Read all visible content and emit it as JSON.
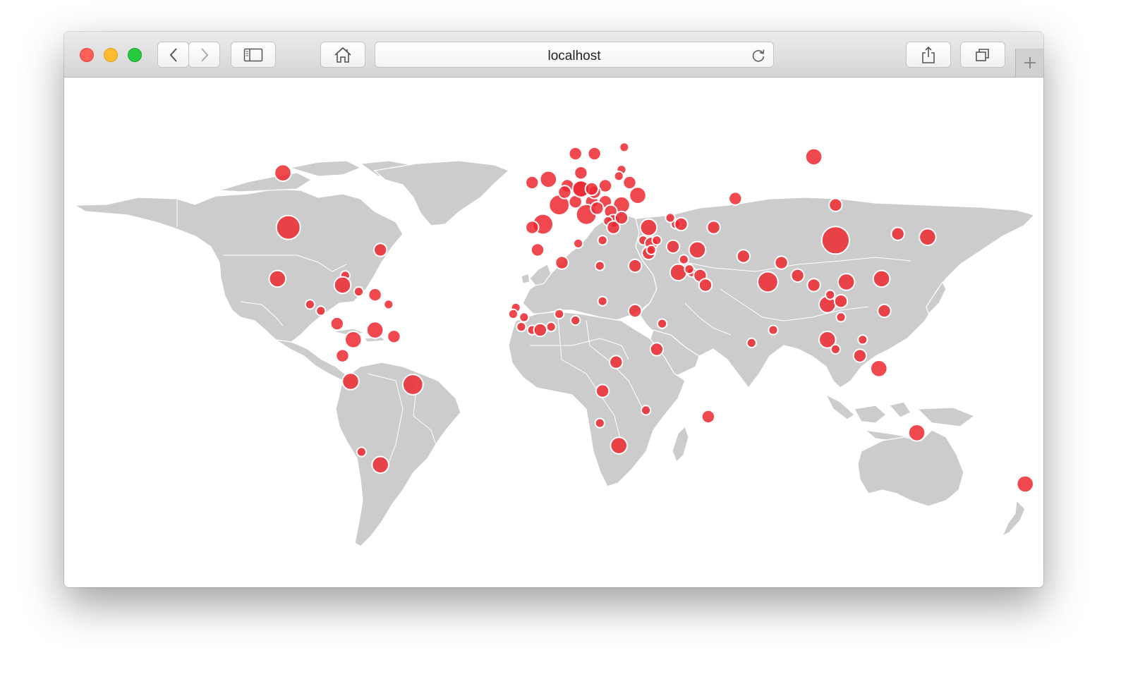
{
  "browser": {
    "url": "localhost",
    "icons": {
      "back": "chevron-left-icon",
      "forward": "chevron-right-icon",
      "sidebar": "sidebar-icon",
      "home": "home-icon",
      "reload": "reload-icon",
      "share": "share-icon",
      "tabs": "tabs-overview-icon",
      "new_tab": "plus-icon"
    }
  },
  "map": {
    "land_color": "#cccccc",
    "marker_color": "#ed2830",
    "marker_stroke": "#ffffff",
    "markers": [
      {
        "lon": -100,
        "lat": 56,
        "size": 3
      },
      {
        "lon": -98,
        "lat": 39,
        "size": 5
      },
      {
        "lon": -102,
        "lat": 23,
        "size": 3
      },
      {
        "lon": -64,
        "lat": 32,
        "size": 2
      },
      {
        "lon": -77,
        "lat": 24,
        "size": 1
      },
      {
        "lon": -78,
        "lat": 21,
        "size": 3
      },
      {
        "lon": -72,
        "lat": 19,
        "size": 1
      },
      {
        "lon": -66,
        "lat": 18,
        "size": 2
      },
      {
        "lon": -61,
        "lat": 15,
        "size": 1
      },
      {
        "lon": -90,
        "lat": 15,
        "size": 1
      },
      {
        "lon": -86,
        "lat": 13,
        "size": 1
      },
      {
        "lon": -80,
        "lat": 9,
        "size": 2
      },
      {
        "lon": -74,
        "lat": 4,
        "size": 3
      },
      {
        "lon": -66,
        "lat": 7,
        "size": 3
      },
      {
        "lon": -59,
        "lat": 5,
        "size": 2
      },
      {
        "lon": -78,
        "lat": -1,
        "size": 2
      },
      {
        "lon": -75,
        "lat": -9,
        "size": 3
      },
      {
        "lon": -52,
        "lat": -10,
        "size": 4
      },
      {
        "lon": -71,
        "lat": -31,
        "size": 1
      },
      {
        "lon": -64,
        "lat": -35,
        "size": 3
      },
      {
        "lon": -8,
        "lat": 53,
        "size": 2
      },
      {
        "lon": -2,
        "lat": 54,
        "size": 3
      },
      {
        "lon": 2,
        "lat": 46,
        "size": 4
      },
      {
        "lon": -4,
        "lat": 40,
        "size": 4
      },
      {
        "lon": -8,
        "lat": 39,
        "size": 2
      },
      {
        "lon": 8,
        "lat": 62,
        "size": 2
      },
      {
        "lon": 15,
        "lat": 62,
        "size": 2
      },
      {
        "lon": 26,
        "lat": 64,
        "size": 1
      },
      {
        "lon": 10,
        "lat": 56,
        "size": 2
      },
      {
        "lon": 5,
        "lat": 52,
        "size": 2
      },
      {
        "lon": 4,
        "lat": 50,
        "size": 2
      },
      {
        "lon": 10,
        "lat": 51,
        "size": 3
      },
      {
        "lon": 8,
        "lat": 47,
        "size": 2
      },
      {
        "lon": 14,
        "lat": 47,
        "size": 2
      },
      {
        "lon": 12,
        "lat": 43,
        "size": 4
      },
      {
        "lon": 19,
        "lat": 52,
        "size": 2
      },
      {
        "lon": 15,
        "lat": 50,
        "size": 2
      },
      {
        "lon": 19,
        "lat": 47,
        "size": 2
      },
      {
        "lon": 25,
        "lat": 57,
        "size": 1
      },
      {
        "lon": 24,
        "lat": 55,
        "size": 1
      },
      {
        "lon": 28,
        "lat": 53,
        "size": 2
      },
      {
        "lon": 31,
        "lat": 49,
        "size": 3
      },
      {
        "lon": 25,
        "lat": 46,
        "size": 3
      },
      {
        "lon": 21,
        "lat": 44,
        "size": 2
      },
      {
        "lon": 16,
        "lat": 45,
        "size": 2
      },
      {
        "lon": 22,
        "lat": 41,
        "size": 2
      },
      {
        "lon": 20,
        "lat": 41,
        "size": 1
      },
      {
        "lon": 22,
        "lat": 39,
        "size": 2
      },
      {
        "lon": 25,
        "lat": 42,
        "size": 2
      },
      {
        "lon": 18,
        "lat": 35,
        "size": 1
      },
      {
        "lon": 35,
        "lat": 39,
        "size": 3
      },
      {
        "lon": 33,
        "lat": 35,
        "size": 1
      },
      {
        "lon": 36,
        "lat": 34,
        "size": 2
      },
      {
        "lon": 35,
        "lat": 31,
        "size": 2
      },
      {
        "lon": 36,
        "lat": 32,
        "size": 1
      },
      {
        "lon": 38,
        "lat": 35,
        "size": 1
      },
      {
        "lon": 44,
        "lat": 33,
        "size": 2
      },
      {
        "lon": 53,
        "lat": 32,
        "size": 3
      },
      {
        "lon": 45,
        "lat": 40,
        "size": 1
      },
      {
        "lon": 43,
        "lat": 42,
        "size": 1
      },
      {
        "lon": 47,
        "lat": 40,
        "size": 2
      },
      {
        "lon": 59,
        "lat": 39,
        "size": 2
      },
      {
        "lon": 67,
        "lat": 48,
        "size": 2
      },
      {
        "lon": 96,
        "lat": 61,
        "size": 3
      },
      {
        "lon": 104,
        "lat": 46,
        "size": 2
      },
      {
        "lon": 104,
        "lat": 35,
        "size": 6
      },
      {
        "lon": 127,
        "lat": 37,
        "size": 2
      },
      {
        "lon": 138,
        "lat": 36,
        "size": 3
      },
      {
        "lon": 70,
        "lat": 30,
        "size": 2
      },
      {
        "lon": 79,
        "lat": 22,
        "size": 4
      },
      {
        "lon": 84,
        "lat": 28,
        "size": 2
      },
      {
        "lon": 90,
        "lat": 24,
        "size": 2
      },
      {
        "lon": 96,
        "lat": 21,
        "size": 2
      },
      {
        "lon": 101,
        "lat": 15,
        "size": 3
      },
      {
        "lon": 106,
        "lat": 11,
        "size": 1
      },
      {
        "lon": 102,
        "lat": 18,
        "size": 1
      },
      {
        "lon": 106,
        "lat": 16,
        "size": 2
      },
      {
        "lon": 108,
        "lat": 22,
        "size": 3
      },
      {
        "lon": 121,
        "lat": 23,
        "size": 3
      },
      {
        "lon": 122,
        "lat": 13,
        "size": 2
      },
      {
        "lon": 101,
        "lat": 4,
        "size": 3
      },
      {
        "lon": 104,
        "lat": 1,
        "size": 1
      },
      {
        "lon": 114,
        "lat": 4,
        "size": 1
      },
      {
        "lon": 113,
        "lat": -1,
        "size": 2
      },
      {
        "lon": 120,
        "lat": -5,
        "size": 3
      },
      {
        "lon": 81,
        "lat": 7,
        "size": 1
      },
      {
        "lon": 73,
        "lat": 3,
        "size": 1
      },
      {
        "lon": 134,
        "lat": -25,
        "size": 3
      },
      {
        "lon": 174,
        "lat": -41,
        "size": 3
      },
      {
        "lon": 57,
        "lat": -20,
        "size": 2
      },
      {
        "lon": 46,
        "lat": 25,
        "size": 3
      },
      {
        "lon": 51,
        "lat": 25,
        "size": 1
      },
      {
        "lon": 50,
        "lat": 26,
        "size": 1
      },
      {
        "lon": 54,
        "lat": 24,
        "size": 2
      },
      {
        "lon": 56,
        "lat": 21,
        "size": 2
      },
      {
        "lon": 48,
        "lat": 29,
        "size": 1
      },
      {
        "lon": 30,
        "lat": 27,
        "size": 2
      },
      {
        "lon": 17,
        "lat": 27,
        "size": 1
      },
      {
        "lon": 9,
        "lat": 34,
        "size": 1
      },
      {
        "lon": 3,
        "lat": 28,
        "size": 2
      },
      {
        "lon": -6,
        "lat": 32,
        "size": 2
      },
      {
        "lon": -14,
        "lat": 14,
        "size": 1
      },
      {
        "lon": -11,
        "lat": 11,
        "size": 1
      },
      {
        "lon": -8,
        "lat": 7,
        "size": 1
      },
      {
        "lon": -5,
        "lat": 7,
        "size": 2
      },
      {
        "lon": -1,
        "lat": 8,
        "size": 1
      },
      {
        "lon": 2,
        "lat": 12,
        "size": 1
      },
      {
        "lon": 8,
        "lat": 10,
        "size": 1
      },
      {
        "lon": -12,
        "lat": 8,
        "size": 1
      },
      {
        "lon": -15,
        "lat": 12,
        "size": 1
      },
      {
        "lon": 18,
        "lat": 16,
        "size": 1
      },
      {
        "lon": 30,
        "lat": 13,
        "size": 2
      },
      {
        "lon": 40,
        "lat": 9,
        "size": 1
      },
      {
        "lon": 38,
        "lat": 1,
        "size": 2
      },
      {
        "lon": 23,
        "lat": -3,
        "size": 2
      },
      {
        "lon": 18,
        "lat": -12,
        "size": 2
      },
      {
        "lon": 34,
        "lat": -18,
        "size": 1
      },
      {
        "lon": 17,
        "lat": -22,
        "size": 1
      },
      {
        "lon": 24,
        "lat": -29,
        "size": 3
      },
      {
        "lon": 10,
        "lat": 51,
        "size": 3
      },
      {
        "lon": 14,
        "lat": 51,
        "size": 2
      }
    ]
  }
}
